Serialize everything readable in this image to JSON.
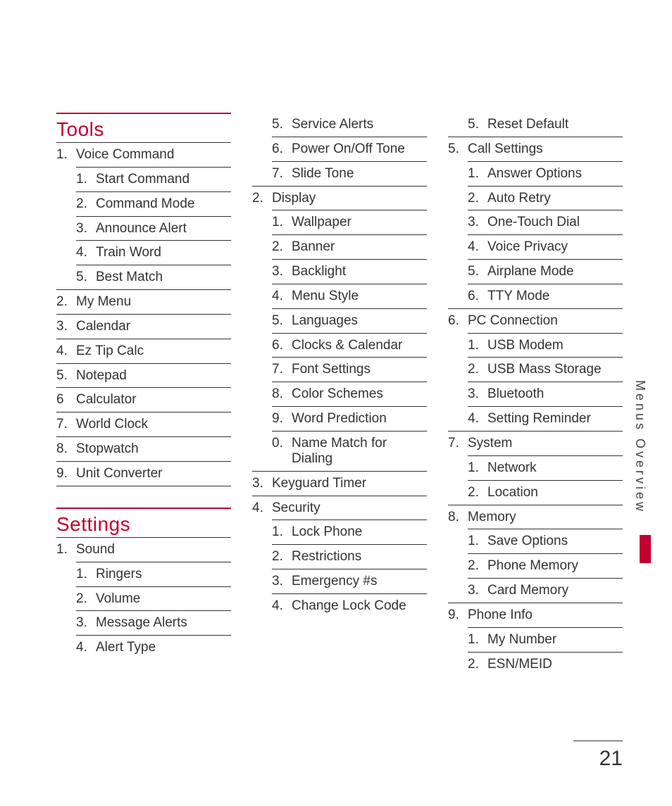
{
  "sideTab": "Menus Overview",
  "pageNumber": "21",
  "columns": [
    [
      {
        "type": "heading",
        "text": "Tools"
      },
      {
        "type": "item",
        "level": 0,
        "num": "1.",
        "label": "Voice Command"
      },
      {
        "type": "item",
        "level": 1,
        "num": "1.",
        "label": "Start Command"
      },
      {
        "type": "item",
        "level": 1,
        "num": "2.",
        "label": "Command Mode"
      },
      {
        "type": "item",
        "level": 1,
        "num": "3.",
        "label": "Announce Alert"
      },
      {
        "type": "item",
        "level": 1,
        "num": "4.",
        "label": "Train Word"
      },
      {
        "type": "item",
        "level": 1,
        "num": "5.",
        "label": "Best Match"
      },
      {
        "type": "item",
        "level": 0,
        "num": "2.",
        "label": "My Menu"
      },
      {
        "type": "item",
        "level": 0,
        "num": "3.",
        "label": "Calendar"
      },
      {
        "type": "item",
        "level": 0,
        "num": "4.",
        "label": "Ez Tip Calc"
      },
      {
        "type": "item",
        "level": 0,
        "num": "5.",
        "label": "Notepad"
      },
      {
        "type": "item",
        "level": 0,
        "num": "6",
        "label": "Calculator"
      },
      {
        "type": "item",
        "level": 0,
        "num": "7.",
        "label": "World Clock"
      },
      {
        "type": "item",
        "level": 0,
        "num": "8.",
        "label": "Stopwatch"
      },
      {
        "type": "item",
        "level": 0,
        "num": "9.",
        "label": "Unit Converter"
      },
      {
        "type": "rule"
      },
      {
        "type": "spacer"
      },
      {
        "type": "heading",
        "text": "Settings"
      },
      {
        "type": "item",
        "level": 0,
        "num": "1.",
        "label": "Sound"
      },
      {
        "type": "item",
        "level": 1,
        "num": "1.",
        "label": "Ringers"
      },
      {
        "type": "item",
        "level": 1,
        "num": "2.",
        "label": "Volume"
      },
      {
        "type": "item",
        "level": 1,
        "num": "3.",
        "label": "Message Alerts"
      },
      {
        "type": "item",
        "level": 1,
        "num": "4.",
        "label": "Alert Type"
      }
    ],
    [
      {
        "type": "item",
        "level": 1,
        "num": "5.",
        "label": "Service Alerts",
        "noTop": true
      },
      {
        "type": "item",
        "level": 1,
        "num": "6.",
        "label": "Power On/Off Tone"
      },
      {
        "type": "item",
        "level": 1,
        "num": "7.",
        "label": "Slide Tone"
      },
      {
        "type": "item",
        "level": 0,
        "num": "2.",
        "label": "Display"
      },
      {
        "type": "item",
        "level": 1,
        "num": "1.",
        "label": "Wallpaper"
      },
      {
        "type": "item",
        "level": 1,
        "num": "2.",
        "label": "Banner"
      },
      {
        "type": "item",
        "level": 1,
        "num": "3.",
        "label": "Backlight"
      },
      {
        "type": "item",
        "level": 1,
        "num": "4.",
        "label": "Menu Style"
      },
      {
        "type": "item",
        "level": 1,
        "num": "5.",
        "label": "Languages"
      },
      {
        "type": "item",
        "level": 1,
        "num": "6.",
        "label": "Clocks & Calendar"
      },
      {
        "type": "item",
        "level": 1,
        "num": "7.",
        "label": "Font Settings"
      },
      {
        "type": "item",
        "level": 1,
        "num": "8.",
        "label": "Color Schemes"
      },
      {
        "type": "item",
        "level": 1,
        "num": "9.",
        "label": "Word Prediction"
      },
      {
        "type": "item",
        "level": 1,
        "num": "0.",
        "label": "Name Match for Dialing"
      },
      {
        "type": "item",
        "level": 0,
        "num": "3.",
        "label": "Keyguard Timer"
      },
      {
        "type": "item",
        "level": 0,
        "num": "4.",
        "label": "Security"
      },
      {
        "type": "item",
        "level": 1,
        "num": "1.",
        "label": "Lock Phone"
      },
      {
        "type": "item",
        "level": 1,
        "num": "2.",
        "label": "Restrictions"
      },
      {
        "type": "item",
        "level": 1,
        "num": "3.",
        "label": "Emergency #s"
      },
      {
        "type": "item",
        "level": 1,
        "num": "4.",
        "label": "Change Lock Code"
      }
    ],
    [
      {
        "type": "item",
        "level": 1,
        "num": "5.",
        "label": "Reset Default",
        "noTop": true
      },
      {
        "type": "item",
        "level": 0,
        "num": "5.",
        "label": "Call Settings"
      },
      {
        "type": "item",
        "level": 1,
        "num": "1.",
        "label": "Answer Options"
      },
      {
        "type": "item",
        "level": 1,
        "num": "2.",
        "label": "Auto Retry"
      },
      {
        "type": "item",
        "level": 1,
        "num": "3.",
        "label": "One-Touch Dial"
      },
      {
        "type": "item",
        "level": 1,
        "num": "4.",
        "label": "Voice Privacy"
      },
      {
        "type": "item",
        "level": 1,
        "num": "5.",
        "label": "Airplane Mode"
      },
      {
        "type": "item",
        "level": 1,
        "num": "6.",
        "label": "TTY Mode"
      },
      {
        "type": "item",
        "level": 0,
        "num": "6.",
        "label": "PC Connection"
      },
      {
        "type": "item",
        "level": 1,
        "num": "1.",
        "label": "USB Modem"
      },
      {
        "type": "item",
        "level": 1,
        "num": "2.",
        "label": "USB Mass Storage"
      },
      {
        "type": "item",
        "level": 1,
        "num": "3.",
        "label": "Bluetooth"
      },
      {
        "type": "item",
        "level": 1,
        "num": "4.",
        "label": "Setting Reminder"
      },
      {
        "type": "item",
        "level": 0,
        "num": "7.",
        "label": "System"
      },
      {
        "type": "item",
        "level": 1,
        "num": "1.",
        "label": "Network"
      },
      {
        "type": "item",
        "level": 1,
        "num": "2.",
        "label": "Location"
      },
      {
        "type": "item",
        "level": 0,
        "num": "8.",
        "label": "Memory"
      },
      {
        "type": "item",
        "level": 1,
        "num": "1.",
        "label": "Save Options"
      },
      {
        "type": "item",
        "level": 1,
        "num": "2.",
        "label": "Phone Memory"
      },
      {
        "type": "item",
        "level": 1,
        "num": "3.",
        "label": "Card Memory"
      },
      {
        "type": "item",
        "level": 0,
        "num": "9.",
        "label": "Phone Info"
      },
      {
        "type": "item",
        "level": 1,
        "num": "1.",
        "label": "My Number"
      },
      {
        "type": "item",
        "level": 1,
        "num": "2.",
        "label": "ESN/MEID"
      }
    ]
  ]
}
